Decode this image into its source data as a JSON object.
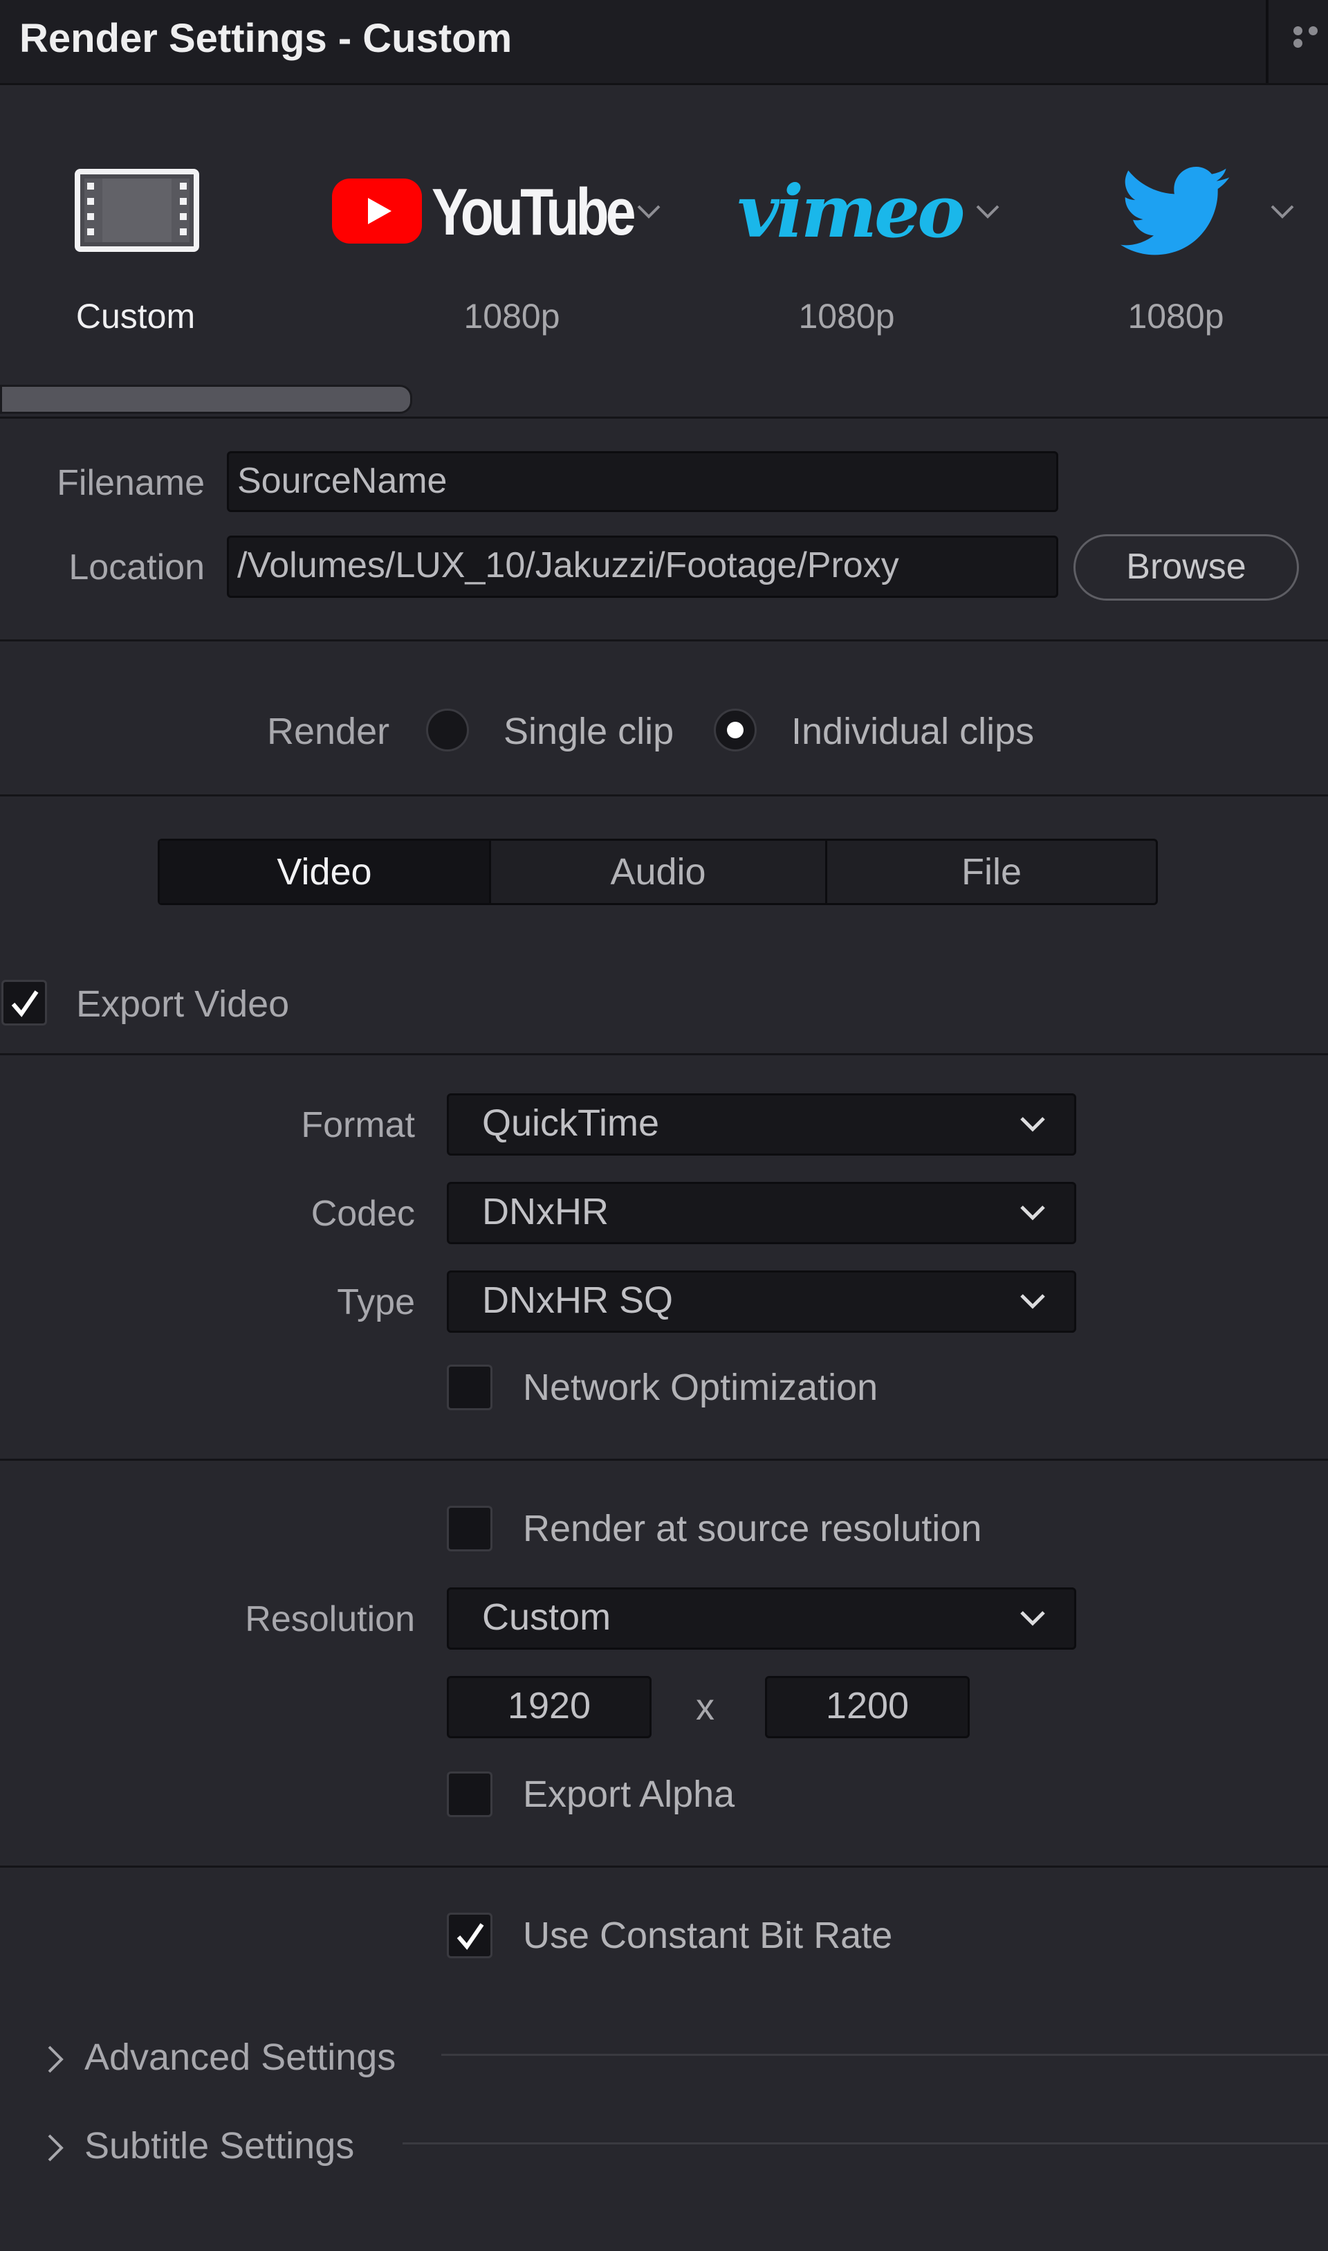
{
  "window": {
    "title": "Render Settings - Custom"
  },
  "presets": [
    {
      "name": "Custom",
      "label": "Custom",
      "icon": "film-strip-icon",
      "active": true
    },
    {
      "name": "YouTube",
      "label": "1080p",
      "icon": "youtube-logo"
    },
    {
      "name": "vimeo",
      "label": "1080p",
      "icon": "vimeo-logo"
    },
    {
      "name": "Twitter",
      "label": "1080p",
      "icon": "twitter-bird-logo"
    }
  ],
  "file": {
    "filename_label": "Filename",
    "filename_value": "SourceName",
    "location_label": "Location",
    "location_value": "/Volumes/LUX_10/Jakuzzi/Footage/Proxy",
    "browse_label": "Browse"
  },
  "render_mode": {
    "label": "Render",
    "single_clip_label": "Single clip",
    "individual_clips_label": "Individual clips",
    "selected": "Individual clips"
  },
  "tabs": [
    "Video",
    "Audio",
    "File"
  ],
  "active_tab": "Video",
  "video": {
    "export_video_label": "Export Video",
    "export_video_checked": true,
    "format_label": "Format",
    "format_value": "QuickTime",
    "codec_label": "Codec",
    "codec_value": "DNxHR",
    "type_label": "Type",
    "type_value": "DNxHR SQ",
    "network_opt_label": "Network Optimization",
    "network_opt_checked": false,
    "source_res_label": "Render at source resolution",
    "source_res_checked": false,
    "resolution_label": "Resolution",
    "resolution_value": "Custom",
    "width": "1920",
    "times": "x",
    "height": "1200",
    "export_alpha_label": "Export Alpha",
    "export_alpha_checked": false,
    "cbr_label": "Use Constant Bit Rate",
    "cbr_checked": true
  },
  "sections": {
    "advanced_label": "Advanced Settings",
    "subtitle_label": "Subtitle Settings"
  },
  "colors": {
    "background": "#27272d",
    "youtube_red": "#ff0000",
    "vimeo_blue": "#1ab7ea",
    "twitter_blue": "#1da1f2"
  }
}
